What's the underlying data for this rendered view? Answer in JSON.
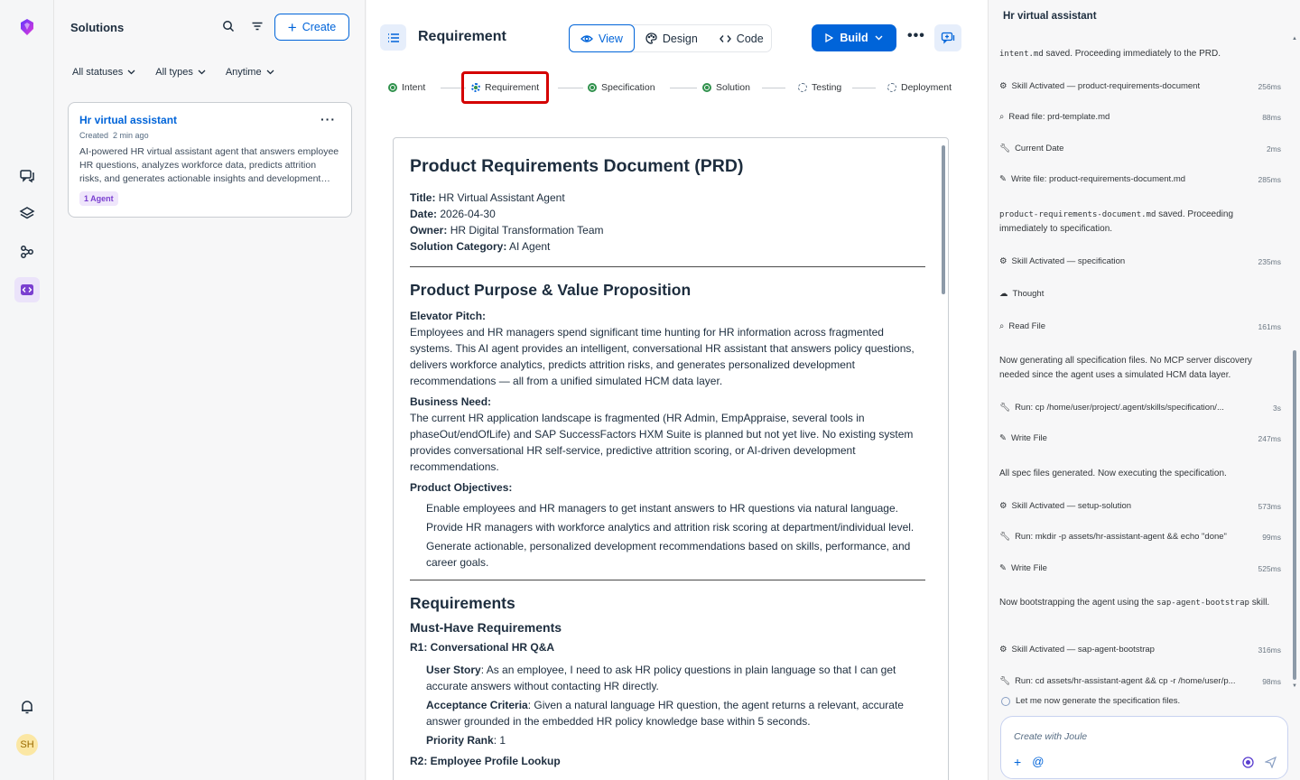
{
  "rail": {
    "icons": [
      "joule-logo-icon",
      "chat-icon",
      "layers-icon",
      "connections-icon",
      "code-icon",
      "bell-icon"
    ],
    "avatar_initials": "SH"
  },
  "solutions": {
    "title": "Solutions",
    "create_label": "Create",
    "filters": [
      "All statuses",
      "All types",
      "Anytime"
    ],
    "card": {
      "title": "Hr virtual assistant",
      "created_label": "Created",
      "created_time": "2 min ago",
      "description": "AI-powered HR virtual assistant agent that answers employee HR questions, analyzes workforce data, predicts attrition risks, and generates actionable insights and development…",
      "badge": "1 Agent"
    }
  },
  "main": {
    "title": "Requirement",
    "view_tabs": [
      "View",
      "Design",
      "Code"
    ],
    "build_label": "Build",
    "steps": [
      {
        "label": "Intent",
        "state": "done"
      },
      {
        "label": "Requirement",
        "state": "current"
      },
      {
        "label": "Specification",
        "state": "done"
      },
      {
        "label": "Solution",
        "state": "done"
      },
      {
        "label": "Testing",
        "state": "pending"
      },
      {
        "label": "Deployment",
        "state": "pending"
      }
    ],
    "doc": {
      "h1": "Product Requirements Document (PRD)",
      "meta": [
        {
          "k": "Title:",
          "v": "HR Virtual Assistant Agent"
        },
        {
          "k": "Date:",
          "v": "2026-04-30"
        },
        {
          "k": "Owner:",
          "v": "HR Digital Transformation Team"
        },
        {
          "k": "Solution Category:",
          "v": "AI Agent"
        }
      ],
      "h2_purpose": "Product Purpose & Value Proposition",
      "pitch_label": "Elevator Pitch:",
      "pitch": "Employees and HR managers spend significant time hunting for HR information across fragmented systems. This AI agent provides an intelligent, conversational HR assistant that answers policy questions, delivers workforce analytics, predicts attrition risks, and generates personalized development recommendations — all from a unified simulated HCM data layer.",
      "need_label": "Business Need:",
      "need": "The current HR application landscape is fragmented (HR Admin, EmpAppraise, several tools in phaseOut/endOfLife) and SAP SuccessFactors HXM Suite is planned but not yet live. No existing system provides conversational HR self-service, predictive attrition scoring, or AI-driven development recommendations.",
      "objectives_label": "Product Objectives:",
      "objectives": [
        "Enable employees and HR managers to get instant answers to HR questions via natural language.",
        "Provide HR managers with workforce analytics and attrition risk scoring at department/individual level.",
        "Generate actionable, personalized development recommendations based on skills, performance, and career goals."
      ],
      "h2_requirements": "Requirements",
      "h3_must": "Must-Have Requirements",
      "r1_title": "R1: Conversational HR Q&A",
      "r1_story_label": "User Story",
      "r1_story": ": As an employee, I need to ask HR policy questions in plain language so that I can get accurate answers without contacting HR directly.",
      "r1_accept_label": "Acceptance Criteria",
      "r1_accept": ": Given a natural language HR question, the agent returns a relevant, accurate answer grounded in the embedded HR policy knowledge base within 5 seconds.",
      "r1_rank_label": "Priority Rank",
      "r1_rank": ": 1",
      "r2_title": "R2: Employee Profile Lookup"
    }
  },
  "assistant": {
    "title": "Hr virtual assistant",
    "logs": [
      {
        "type": "msg",
        "code": "intent.md",
        "text": " saved. Proceeding immediately to the PRD."
      },
      {
        "type": "tool",
        "icon": "skill-icon",
        "text": "Skill Activated — product-requirements-document",
        "ms": "256ms"
      },
      {
        "type": "tool",
        "icon": "search-icon",
        "text": "Read file: prd-template.md",
        "ms": "88ms"
      },
      {
        "type": "tool",
        "icon": "wrench-icon",
        "text": "Current Date",
        "ms": "2ms"
      },
      {
        "type": "tool",
        "icon": "write-file-icon",
        "text": "Write file: product-requirements-document.md",
        "ms": "285ms"
      },
      {
        "type": "msg",
        "code": "product-requirements-document.md",
        "text": " saved. Proceeding immediately to specification."
      },
      {
        "type": "tool",
        "icon": "skill-icon",
        "text": "Skill Activated — specification",
        "ms": "235ms"
      },
      {
        "type": "tool",
        "icon": "thought-icon",
        "text": "Thought",
        "ms": ""
      },
      {
        "type": "tool",
        "icon": "search-icon",
        "text": "Read File",
        "ms": "161ms"
      },
      {
        "type": "msg",
        "code": "",
        "text": "Now generating all specification files. No MCP server discovery needed since the agent uses a simulated HCM data layer."
      },
      {
        "type": "tool",
        "icon": "wrench-icon",
        "text": "Run: cp /home/user/project/.agent/skills/specification/...",
        "ms": "3s"
      },
      {
        "type": "tool",
        "icon": "write-file-icon",
        "text": "Write File",
        "ms": "247ms"
      },
      {
        "type": "msg",
        "code": "",
        "text": "All spec files generated. Now executing the specification."
      },
      {
        "type": "tool",
        "icon": "skill-icon",
        "text": "Skill Activated — setup-solution",
        "ms": "573ms"
      },
      {
        "type": "tool",
        "icon": "wrench-icon",
        "text": "Run: mkdir -p assets/hr-assistant-agent && echo \"done\"",
        "ms": "99ms"
      },
      {
        "type": "tool",
        "icon": "write-file-icon",
        "text": "Write File",
        "ms": "525ms"
      },
      {
        "type": "msg",
        "code": "sap-agent-bootstrap",
        "text_before": "Now bootstrapping the agent using the ",
        "text_after": " skill."
      },
      {
        "type": "tool",
        "icon": "skill-icon",
        "text": "Skill Activated — sap-agent-bootstrap",
        "ms": "316ms"
      },
      {
        "type": "tool",
        "icon": "wrench-icon",
        "text": "Run: cd assets/hr-assistant-agent && cp -r /home/user/p...",
        "ms": "98ms"
      }
    ],
    "thinking": "Let me now generate the specification files.",
    "input_placeholder": "Create with Joule"
  }
}
